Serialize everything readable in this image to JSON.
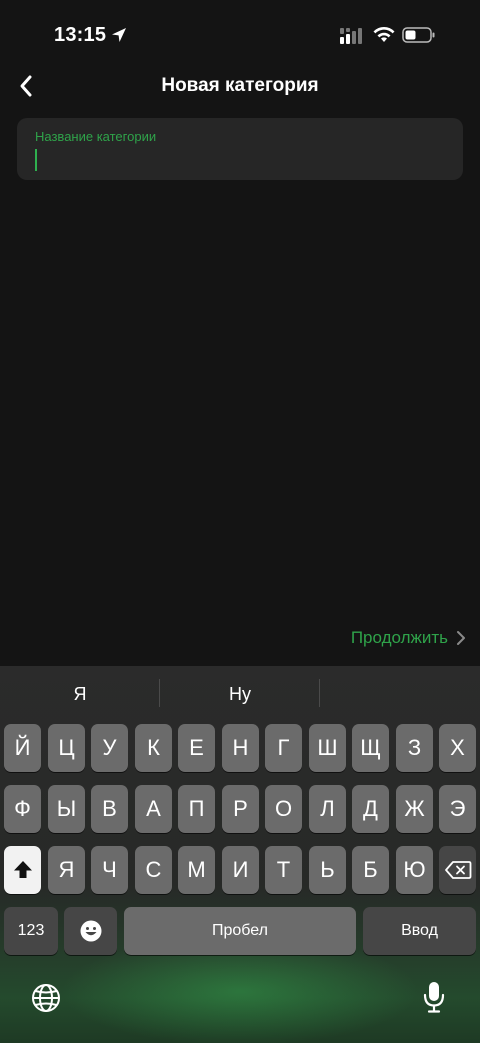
{
  "status": {
    "time": "13:15"
  },
  "nav": {
    "title": "Новая категория"
  },
  "field": {
    "label": "Название категории",
    "value": ""
  },
  "continue": {
    "label": "Продолжить"
  },
  "keyboard": {
    "suggestions": [
      "Я",
      "Ну",
      ""
    ],
    "row1": [
      "Й",
      "Ц",
      "У",
      "К",
      "Е",
      "Н",
      "Г",
      "Ш",
      "Щ",
      "З",
      "Х"
    ],
    "row2": [
      "Ф",
      "Ы",
      "В",
      "А",
      "П",
      "Р",
      "О",
      "Л",
      "Д",
      "Ж",
      "Э"
    ],
    "row3": [
      "Я",
      "Ч",
      "С",
      "М",
      "И",
      "Т",
      "Ь",
      "Б",
      "Ю"
    ],
    "numbers_label": "123",
    "space_label": "Пробел",
    "return_label": "Ввод"
  },
  "colors": {
    "accent": "#2fa34a",
    "background": "#141414",
    "field": "#262626"
  }
}
